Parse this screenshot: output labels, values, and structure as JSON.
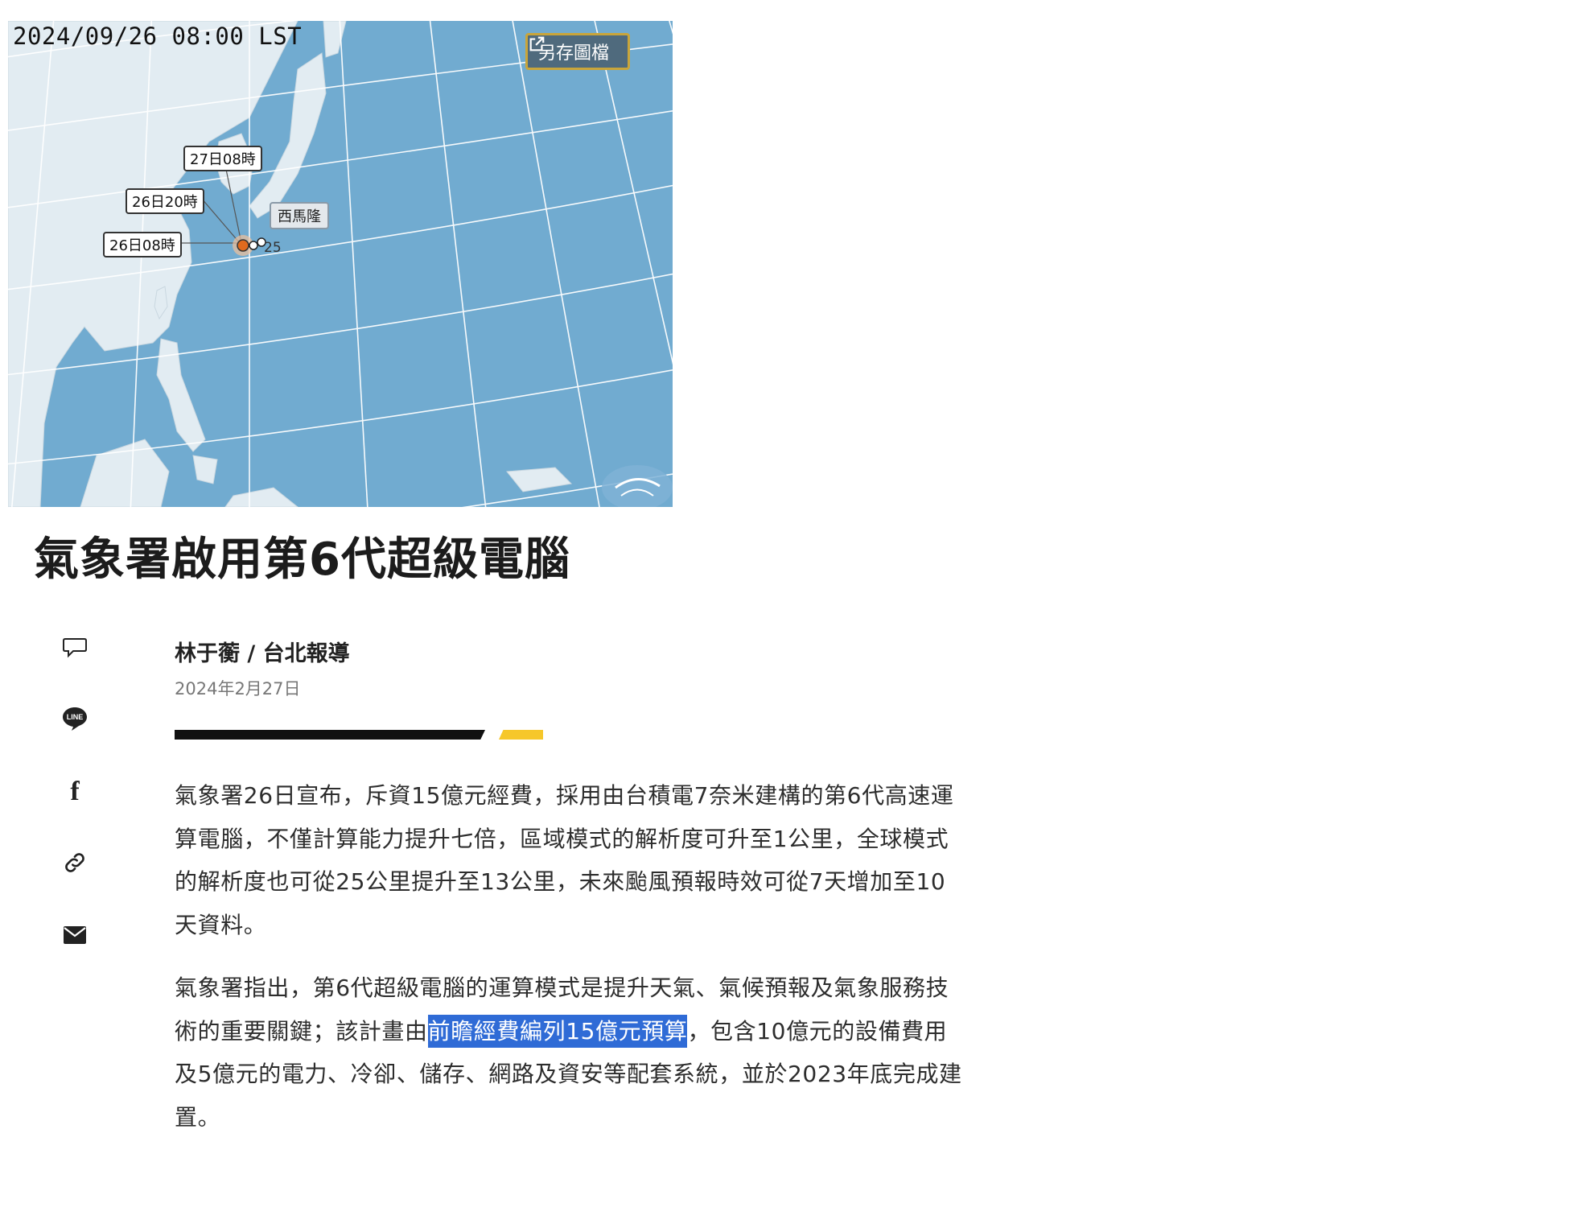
{
  "map": {
    "timestamp": "2024/09/26 08:00 LST",
    "save_label": "另存圖檔",
    "track_labels": [
      "27日08時",
      "26日20時",
      "26日08時"
    ],
    "storm_name": "西馬隆",
    "storm_number": "25",
    "colors": {
      "sea": "#71abd0",
      "land": "#e2ecf2",
      "button_border": "#c9a53a",
      "storm": "#e06a1e"
    }
  },
  "article": {
    "title": "氣象署啟用第6代超級電腦",
    "byline": "林于蘅 / 台北報導",
    "date": "2024年2月27日",
    "paragraphs": [
      {
        "text": "氣象署26日宣布，斥資15億元經費，採用由台積電7奈米建構的第6代高速運算電腦，不僅計算能力提升七倍，區域模式的解析度可升至1公里，全球模式的解析度也可從25公里提升至13公里，未來颱風預報時效可從7天增加至10天資料。"
      },
      {
        "before": "氣象署指出，第6代超級電腦的運算模式是提升天氣、氣候預報及氣象服務技術的重要關鍵；該計畫由",
        "highlight": "前瞻經費編列15億元預算",
        "after": "，包含10億元的設備費用及5億元的電力、冷卻、儲存、網路及資安等配套系統，並於2023年底完成建置。"
      }
    ]
  },
  "share": {
    "icons": [
      "comment-icon",
      "line-icon",
      "facebook-icon",
      "link-icon",
      "mail-icon"
    ],
    "line_text": "LINE",
    "facebook_text": "f"
  },
  "colors": {
    "selection": "#2f6bd6",
    "accent_rule": "#f6c72a"
  }
}
